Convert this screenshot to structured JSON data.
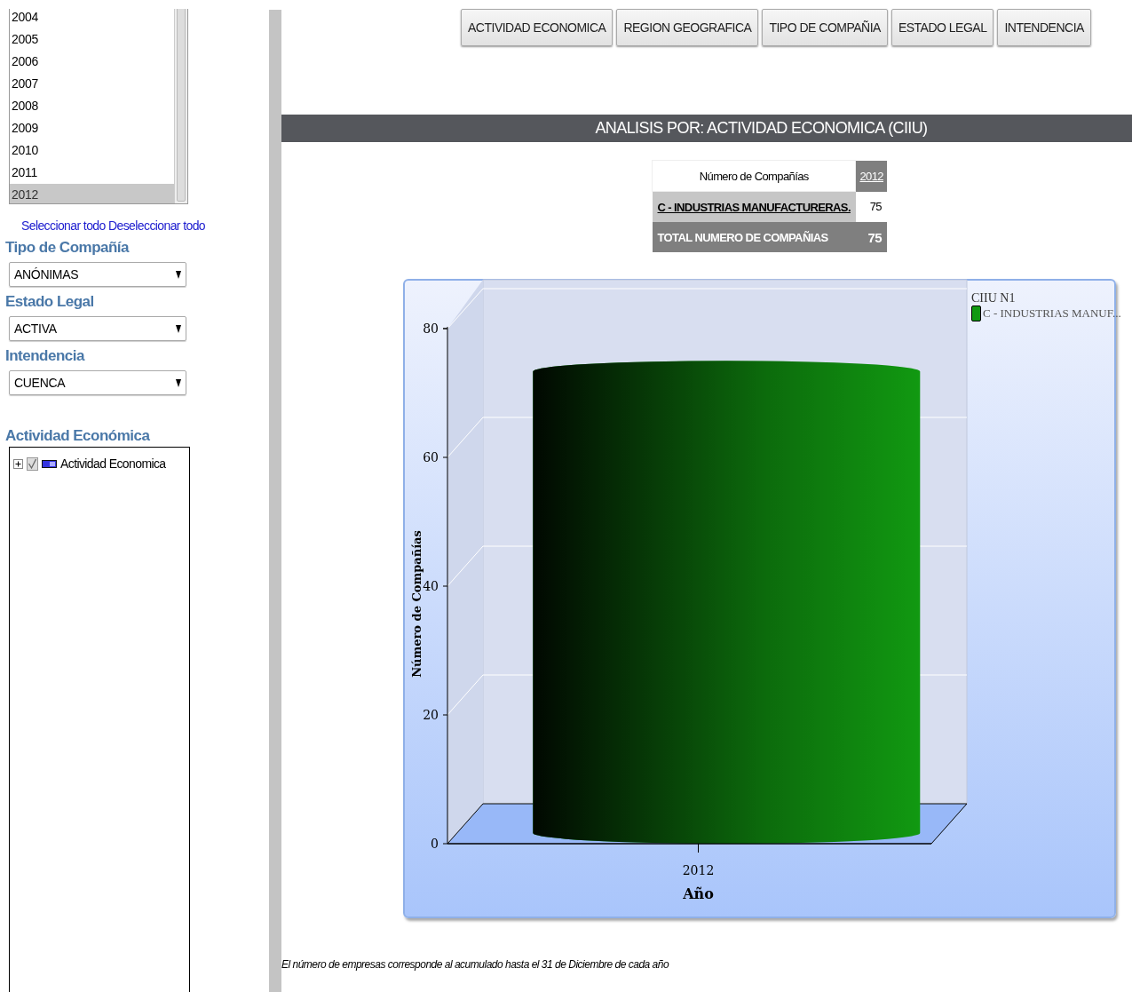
{
  "years": [
    {
      "label": "2004",
      "selected": false
    },
    {
      "label": "2005",
      "selected": false
    },
    {
      "label": "2006",
      "selected": false
    },
    {
      "label": "2007",
      "selected": false
    },
    {
      "label": "2008",
      "selected": false
    },
    {
      "label": "2009",
      "selected": false
    },
    {
      "label": "2010",
      "selected": false
    },
    {
      "label": "2011",
      "selected": false
    },
    {
      "label": "2012",
      "selected": true
    }
  ],
  "select_links": [
    "Seleccionar todo",
    "Deseleccionar todo"
  ],
  "filters": [
    {
      "label": "Tipo de Compañía",
      "value": "ANÓNIMAS"
    },
    {
      "label": "Estado Legal",
      "value": "ACTIVA"
    },
    {
      "label": "Intendencia",
      "value": "CUENCA"
    }
  ],
  "activity_tree": {
    "title": "Actividad Económica",
    "items": [
      {
        "label": "Actividad Economica",
        "checked": true,
        "expanded": false
      }
    ]
  },
  "tabs": [
    "ACTIVIDAD ECONOMICA",
    "REGION GEOGRAFICA",
    "TIPO DE COMPAÑIA",
    "ESTADO LEGAL",
    "INTENDENCIA"
  ],
  "section_title": "ANALISIS POR: ACTIVIDAD ECONOMICA (CIIU)",
  "summary_table": {
    "header": "Número de Compañías",
    "column": "2012",
    "rows": [
      {
        "label": "C - INDUSTRIAS MANUFACTURERAS.",
        "value": "75"
      }
    ],
    "total": {
      "label": "TOTAL NUMERO DE COMPAÑIAS",
      "value": "75"
    }
  },
  "chart": {
    "legend_title": "CIIU N1",
    "chart_data": {
      "type": "bar",
      "xlabel": "Año",
      "ylabel": "Número de Compañías",
      "categories": [
        "2012"
      ],
      "series": [
        {
          "name": "C - INDUSTRIAS MANUF...",
          "color": "#119911",
          "values": [
            75
          ]
        }
      ],
      "ylim": [
        0,
        80
      ],
      "yticks": [
        0,
        20,
        40,
        60,
        80
      ]
    }
  },
  "footnote": "El número de empresas corresponde al acumulado hasta el 31 de Diciembre de cada año"
}
